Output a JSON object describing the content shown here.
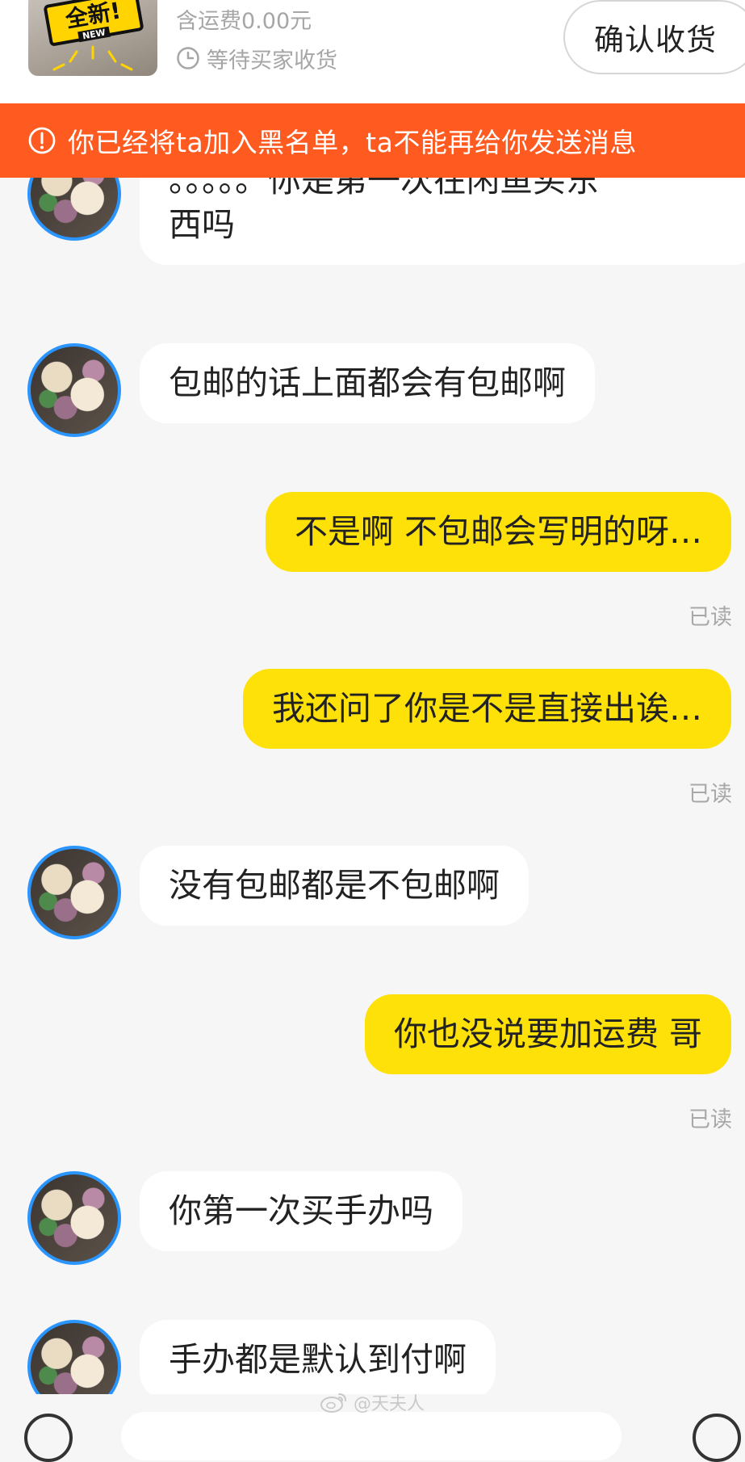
{
  "order": {
    "thumb_badge": "全新!",
    "thumb_new": "NEW",
    "shipping_fee": "含运费0.00元",
    "status": "等待买家收货",
    "confirm_button": "确认收货",
    "status_icon": "clock-icon"
  },
  "banner": {
    "icon": "alert-circle-icon",
    "text": "你已经将ta加入黑名单，ta不能再给你发送消息",
    "color": "#ff5a1f"
  },
  "messages": [
    {
      "side": "in",
      "text_line1": "。。。。。你是第一次在闲鱼买东",
      "text_line2": "西吗"
    },
    {
      "side": "in",
      "text": "包邮的话上面都会有包邮啊"
    },
    {
      "side": "out",
      "text": "不是啊 不包邮会写明的呀…",
      "read": "已读"
    },
    {
      "side": "out",
      "text": "我还问了你是不是直接出诶…",
      "read": "已读"
    },
    {
      "side": "in",
      "text": "没有包邮都是不包邮啊"
    },
    {
      "side": "out",
      "text": "你也没说要加运费 哥",
      "read": "已读"
    },
    {
      "side": "in",
      "text": "你第一次买手办吗"
    },
    {
      "side": "in",
      "text": "手办都是默认到付啊"
    }
  ],
  "colors": {
    "outgoing_bubble": "#ffe10a",
    "incoming_bubble": "#ffffff",
    "background": "#f6f6f6",
    "avatar_ring": "#2a95ff"
  },
  "watermark": {
    "icon": "weibo-icon",
    "text": "@天夫人"
  }
}
